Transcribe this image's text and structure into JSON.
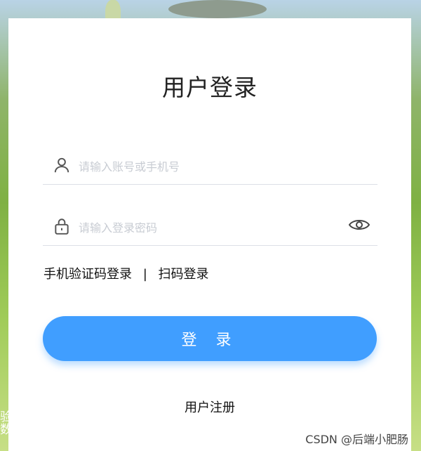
{
  "login": {
    "title": "用户登录",
    "username_placeholder": "请输入账号或手机号",
    "password_placeholder": "请输入登录密码",
    "alt_sms": "手机验证码登录",
    "alt_sep": "|",
    "alt_qr": "扫码登录",
    "login_button": "登 录",
    "register_link": "用户注册"
  },
  "watermark": "CSDN @后端小肥肠",
  "icons": {
    "user": "user-icon",
    "lock": "lock-icon",
    "eye": "eye-icon"
  },
  "colors": {
    "primary": "#409eff",
    "card_bg": "#ffffff",
    "placeholder": "#c8ccd3"
  }
}
